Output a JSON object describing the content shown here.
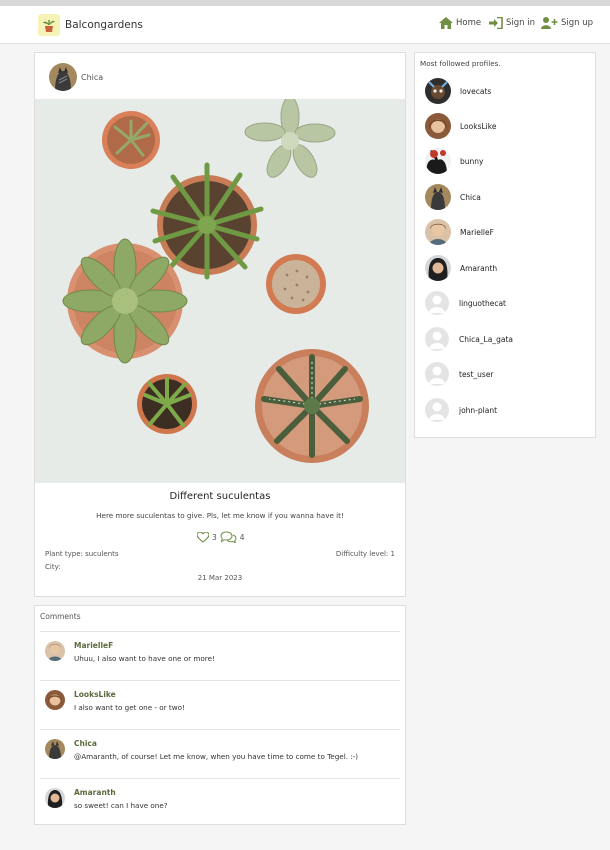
{
  "app": {
    "brand": "Balcongardens",
    "logo_icon": "potted-plant-icon"
  },
  "nav": {
    "home": "Home",
    "sign_in": "Sign in",
    "sign_up": "Sign up",
    "accent": "#6f8f45"
  },
  "post": {
    "author": "Chica",
    "title": "Different suculentas",
    "description": "Here more suculentas to give. Pls, let me know if you wanna have it!",
    "likes": "3",
    "comments_count": "4",
    "plant_type": "Plant type: suculents",
    "difficulty": "Difficulty level: 1",
    "city": "City:",
    "date": "21 Mar 2023"
  },
  "comments": {
    "title": "Comments",
    "items": [
      {
        "author": "MarielleF",
        "text": "Uhuu, I also want to have one or more!"
      },
      {
        "author": "LooksLike",
        "text": "I also want to get one - or two!"
      },
      {
        "author": "Chica",
        "text": "@Amaranth, of course! Let me know, when you have time to come to Tegel. :-)"
      },
      {
        "author": "Amaranth",
        "text": "so sweet! can I have one?"
      }
    ]
  },
  "sidebar": {
    "title": "Most followed profiles.",
    "profiles": [
      {
        "name": "lovecats"
      },
      {
        "name": "LooksLike"
      },
      {
        "name": "bunny"
      },
      {
        "name": "Chica"
      },
      {
        "name": "MarielleF"
      },
      {
        "name": "Amaranth"
      },
      {
        "name": "linguothecat"
      },
      {
        "name": "Chica_La_gata"
      },
      {
        "name": "test_user"
      },
      {
        "name": "john-plant"
      }
    ]
  }
}
